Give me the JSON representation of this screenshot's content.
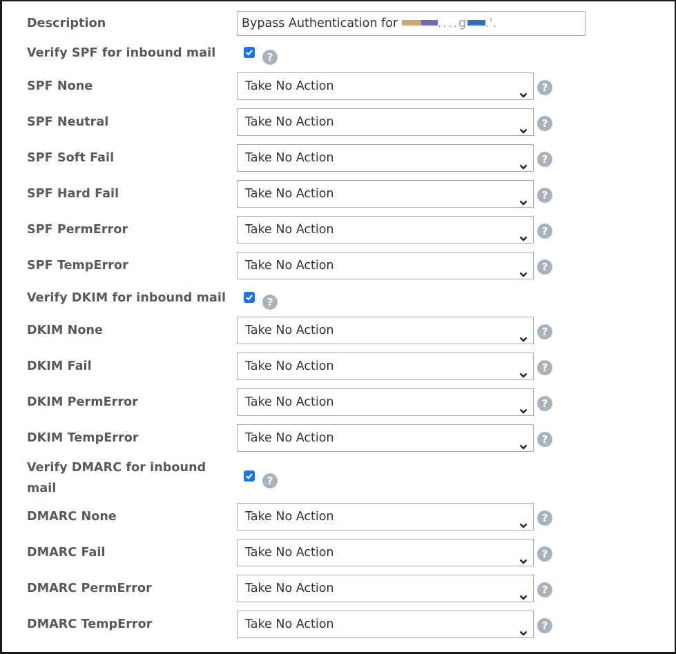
{
  "description": {
    "label": "Description",
    "value_prefix": "Bypass Authentication for ",
    "value_redacted_colors": [
      "#d4a574",
      "#7068b8",
      "#ffffff",
      "#3070c0"
    ]
  },
  "colors": {
    "label_text": "#595959",
    "checkbox": "#1a73e8",
    "help_icon": "#a9b2bb",
    "border": "#a9a9a9"
  },
  "fields": [
    {
      "type": "checkbox",
      "label": "Verify SPF for inbound mail",
      "checked": true,
      "name": "verify-spf-checkbox"
    },
    {
      "type": "select",
      "label": "SPF None",
      "value": "Take No Action",
      "name": "spf-none-select"
    },
    {
      "type": "select",
      "label": "SPF Neutral",
      "value": "Take No Action",
      "name": "spf-neutral-select"
    },
    {
      "type": "select",
      "label": "SPF Soft Fail",
      "value": "Take No Action",
      "name": "spf-soft-fail-select"
    },
    {
      "type": "select",
      "label": "SPF Hard Fail",
      "value": "Take No Action",
      "name": "spf-hard-fail-select"
    },
    {
      "type": "select",
      "label": "SPF PermError",
      "value": "Take No Action",
      "name": "spf-permerror-select"
    },
    {
      "type": "select",
      "label": "SPF TempError",
      "value": "Take No Action",
      "name": "spf-temperror-select"
    },
    {
      "type": "checkbox",
      "label": "Verify DKIM for inbound mail",
      "checked": true,
      "name": "verify-dkim-checkbox"
    },
    {
      "type": "select",
      "label": "DKIM None",
      "value": "Take No Action",
      "name": "dkim-none-select"
    },
    {
      "type": "select",
      "label": "DKIM Fail",
      "value": "Take No Action",
      "name": "dkim-fail-select"
    },
    {
      "type": "select",
      "label": "DKIM PermError",
      "value": "Take No Action",
      "name": "dkim-permerror-select"
    },
    {
      "type": "select",
      "label": "DKIM TempError",
      "value": "Take No Action",
      "name": "dkim-temperror-select"
    },
    {
      "type": "checkbox",
      "label": "Verify DMARC for inbound mail",
      "checked": true,
      "name": "verify-dmarc-checkbox"
    },
    {
      "type": "select",
      "label": "DMARC None",
      "value": "Take No Action",
      "name": "dmarc-none-select"
    },
    {
      "type": "select",
      "label": "DMARC Fail",
      "value": "Take No Action",
      "name": "dmarc-fail-select"
    },
    {
      "type": "select",
      "label": "DMARC PermError",
      "value": "Take No Action",
      "name": "dmarc-permerror-select"
    },
    {
      "type": "select",
      "label": "DMARC TempError",
      "value": "Take No Action",
      "name": "dmarc-temperror-select"
    }
  ],
  "icons": {
    "help": "question-circle-icon",
    "dropdown": "chevron-down-icon",
    "check": "checkmark-icon"
  },
  "help_glyph": "?"
}
